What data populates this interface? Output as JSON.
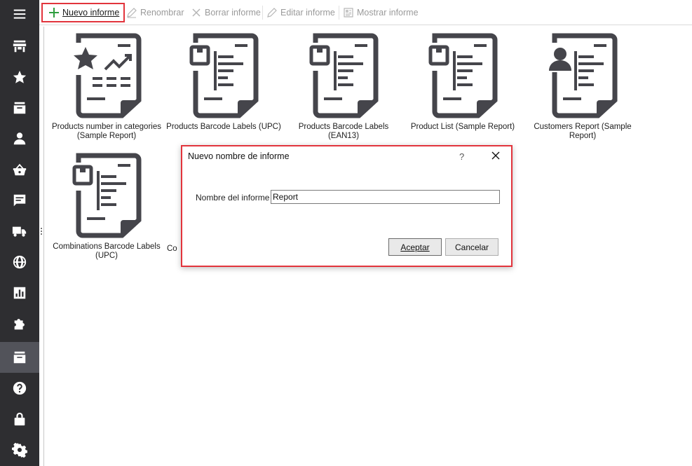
{
  "toolbar": {
    "new_report": "Nuevo informe",
    "rename": "Renombrar",
    "delete_report": "Borrar informe",
    "edit_report": "Editar informe",
    "show_report": "Mostrar informe"
  },
  "sidebar": {
    "items": [
      {
        "icon": "menu-icon"
      },
      {
        "icon": "store-icon"
      },
      {
        "icon": "star-icon"
      },
      {
        "icon": "inbox-icon"
      },
      {
        "icon": "person-icon"
      },
      {
        "icon": "basket-icon"
      },
      {
        "icon": "chat-icon"
      },
      {
        "icon": "truck-icon"
      },
      {
        "icon": "globe-icon"
      },
      {
        "icon": "chart-icon"
      },
      {
        "icon": "puzzle-icon"
      },
      {
        "icon": "reports-icon"
      },
      {
        "icon": "help-icon"
      },
      {
        "icon": "lock-icon"
      },
      {
        "icon": "gear-icon"
      }
    ]
  },
  "reports": [
    {
      "caption": "Products number in categories (Sample Report)",
      "icon": "report-star-chart-icon"
    },
    {
      "caption": "Products Barcode Labels (UPC)",
      "icon": "report-barcode-icon"
    },
    {
      "caption": "Products Barcode Labels (EAN13)",
      "icon": "report-barcode-icon"
    },
    {
      "caption": "Product List (Sample Report)",
      "icon": "report-barcode-icon"
    },
    {
      "caption": "Customers Report (Sample Report)",
      "icon": "report-person-icon"
    },
    {
      "caption": "Combinations Barcode Labels (UPC)",
      "icon": "report-barcode-icon"
    },
    {
      "caption": "Co",
      "icon": "report-barcode-icon"
    }
  ],
  "dialog": {
    "title": "Nuevo nombre de informe",
    "help": "?",
    "label": "Nombre del informe",
    "value": "Report",
    "ok": "Aceptar",
    "cancel": "Cancelar"
  },
  "colors": {
    "sidebar_bg": "#2e2e31",
    "sidebar_active": "#52535a",
    "highlight": "#e2343c",
    "icon_dark": "#45454b",
    "add_green": "#2e9e3e"
  }
}
